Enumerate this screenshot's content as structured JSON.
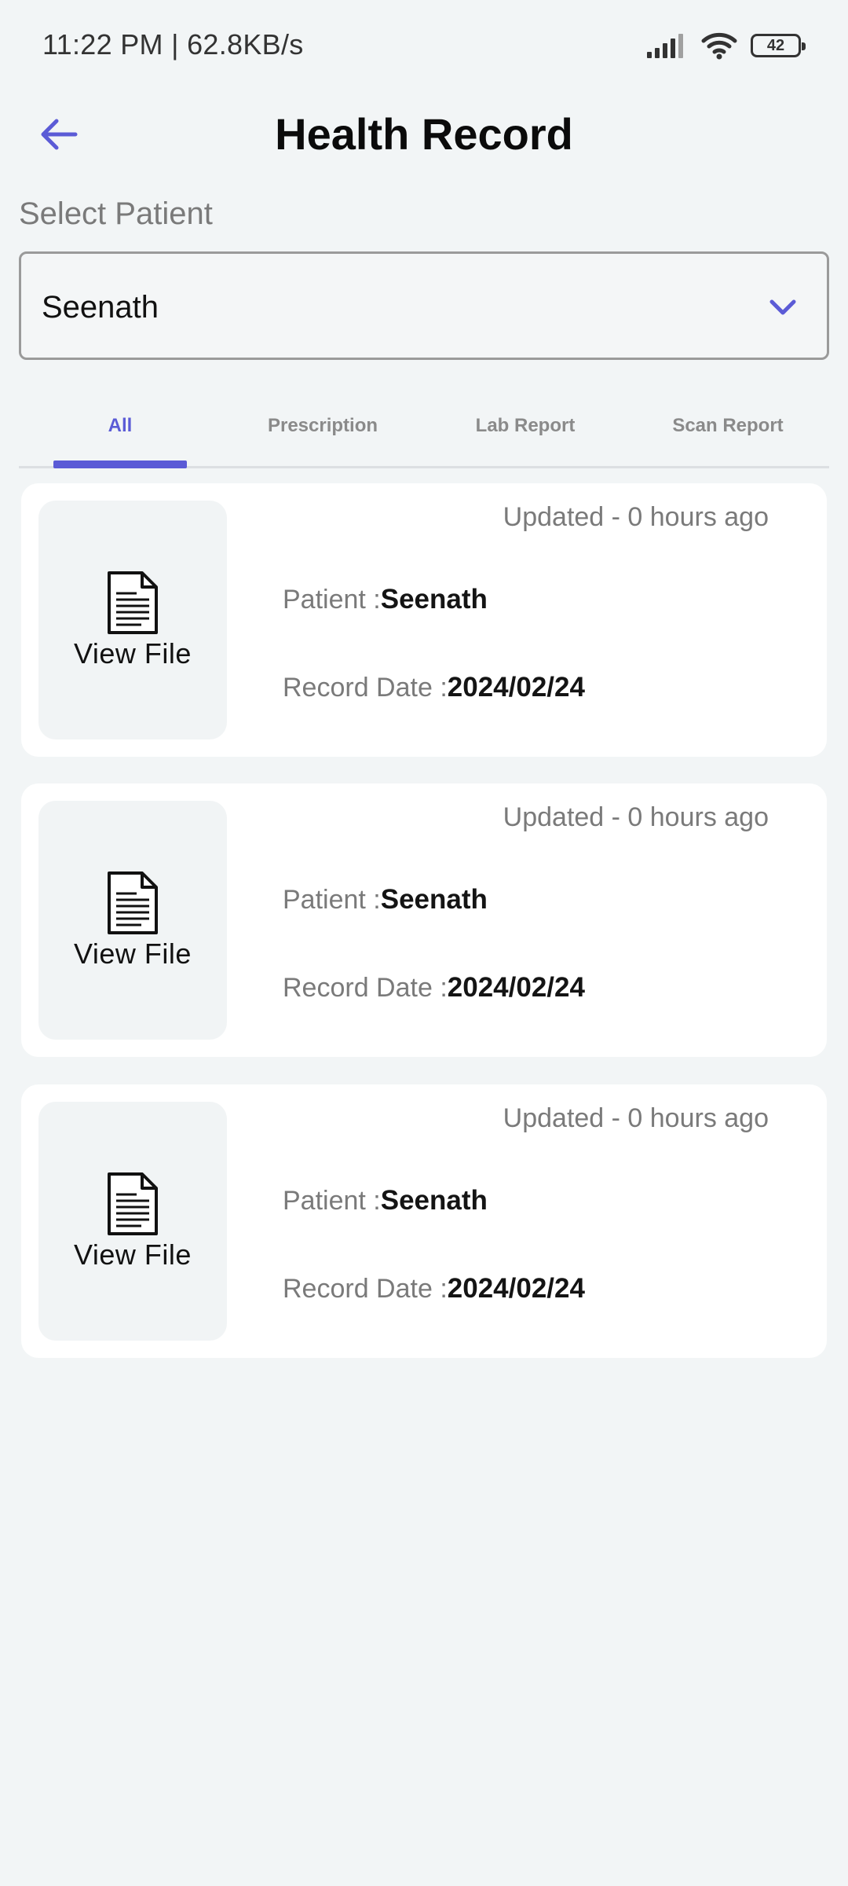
{
  "status_bar": {
    "time_speed": "11:22 PM | 62.8KB/s",
    "battery": "42"
  },
  "header": {
    "title": "Health Record",
    "back_icon": "arrow-left-icon"
  },
  "patient_select": {
    "label": "Select Patient",
    "value": "Seenath"
  },
  "tabs": [
    {
      "label": "All",
      "active": true
    },
    {
      "label": "Prescription",
      "active": false
    },
    {
      "label": "Lab Report",
      "active": false
    },
    {
      "label": "Scan Report",
      "active": false
    }
  ],
  "records": [
    {
      "view_label": "View File",
      "updated": "Updated - 0 hours ago",
      "patient_label": "Patient :",
      "patient": "Seenath",
      "date_label": "Record Date :",
      "date": "2024/02/24"
    },
    {
      "view_label": "View File",
      "updated": "Updated - 0 hours ago",
      "patient_label": "Patient :",
      "patient": "Seenath",
      "date_label": "Record Date :",
      "date": "2024/02/24"
    },
    {
      "view_label": "View File",
      "updated": "Updated - 0 hours ago",
      "patient_label": "Patient :",
      "patient": "Seenath",
      "date_label": "Record Date :",
      "date": "2024/02/24"
    }
  ],
  "colors": {
    "accent": "#5b5bd6",
    "background": "#f2f5f6",
    "card": "#ffffff"
  }
}
